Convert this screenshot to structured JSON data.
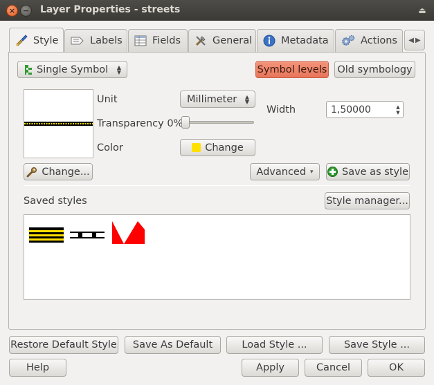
{
  "window": {
    "title": "Layer Properties - streets",
    "close_glyph": "×",
    "minimize_glyph": "−",
    "menu_glyph": "⏏"
  },
  "tabs": [
    {
      "label": "Style",
      "icon": "brush-icon"
    },
    {
      "label": "Labels",
      "icon": "labels-icon"
    },
    {
      "label": "Fields",
      "icon": "table-icon"
    },
    {
      "label": "General",
      "icon": "tools-icon"
    },
    {
      "label": "Metadata",
      "icon": "info-icon"
    },
    {
      "label": "Actions",
      "icon": "gears-icon"
    }
  ],
  "tab_scroll": {
    "left": "◀",
    "right": "▶"
  },
  "style": {
    "renderer_select": "Single Symbol",
    "symbol_levels_button": "Symbol levels",
    "old_symbology_button": "Old symbology",
    "unit_label": "Unit",
    "unit_value": "Millimeter",
    "transparency_label": "Transparency 0%",
    "transparency_value": 0,
    "color_label": "Color",
    "color_button": "Change",
    "color_swatch": "#ffe000",
    "width_label": "Width",
    "width_value": "1,50000",
    "change_button": "Change...",
    "advanced_button": "Advanced",
    "save_as_style_button": "Save as style",
    "saved_styles_label": "Saved styles",
    "style_manager_button": "Style manager...",
    "symbol_colors": {
      "line": "#ffe000",
      "casing": "#000000",
      "accent_red": "#ff0000"
    }
  },
  "footer": {
    "restore_default": "Restore Default Style",
    "save_as_default": "Save As Default",
    "load_style": "Load Style ...",
    "save_style": "Save Style ...",
    "help": "Help",
    "apply": "Apply",
    "cancel": "Cancel",
    "ok": "OK"
  },
  "arrows": {
    "up": "▲",
    "down": "▼",
    "dropdown": "▾"
  }
}
